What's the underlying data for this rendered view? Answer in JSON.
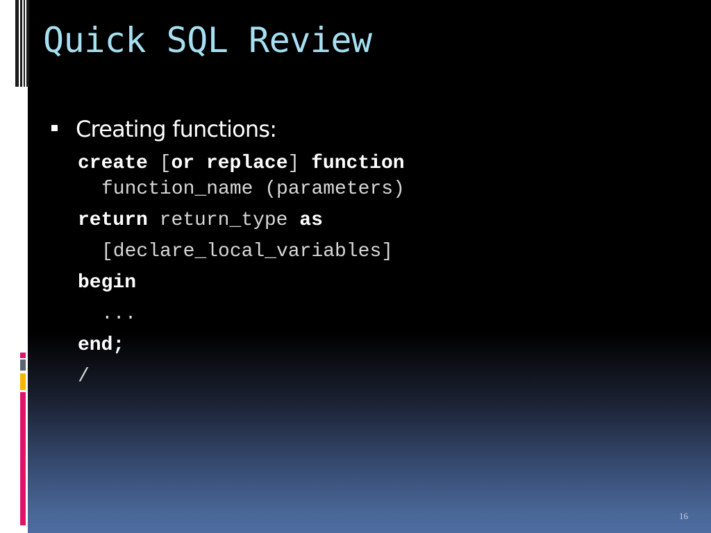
{
  "slide": {
    "title": "Quick SQL Review",
    "bullet": "Creating functions:",
    "code": {
      "line1": {
        "create": "create",
        "open_bracket": "[",
        "or": "or",
        "replace": "replace",
        "close_bracket": "]",
        "function": "function"
      },
      "line2": "function_name (parameters)",
      "line3": {
        "return": "return",
        "return_type": "return_type",
        "as": "as"
      },
      "line4": "[declare_local_variables]",
      "line5": "begin",
      "line6": "...",
      "line7": "end;",
      "line8": "/"
    },
    "slide_number": "16"
  },
  "theme": {
    "title_color": "#a6e0f2",
    "text_color": "#ffffff",
    "accent_colors": [
      "#e0136b",
      "#f7b500",
      "#5b6470"
    ]
  }
}
